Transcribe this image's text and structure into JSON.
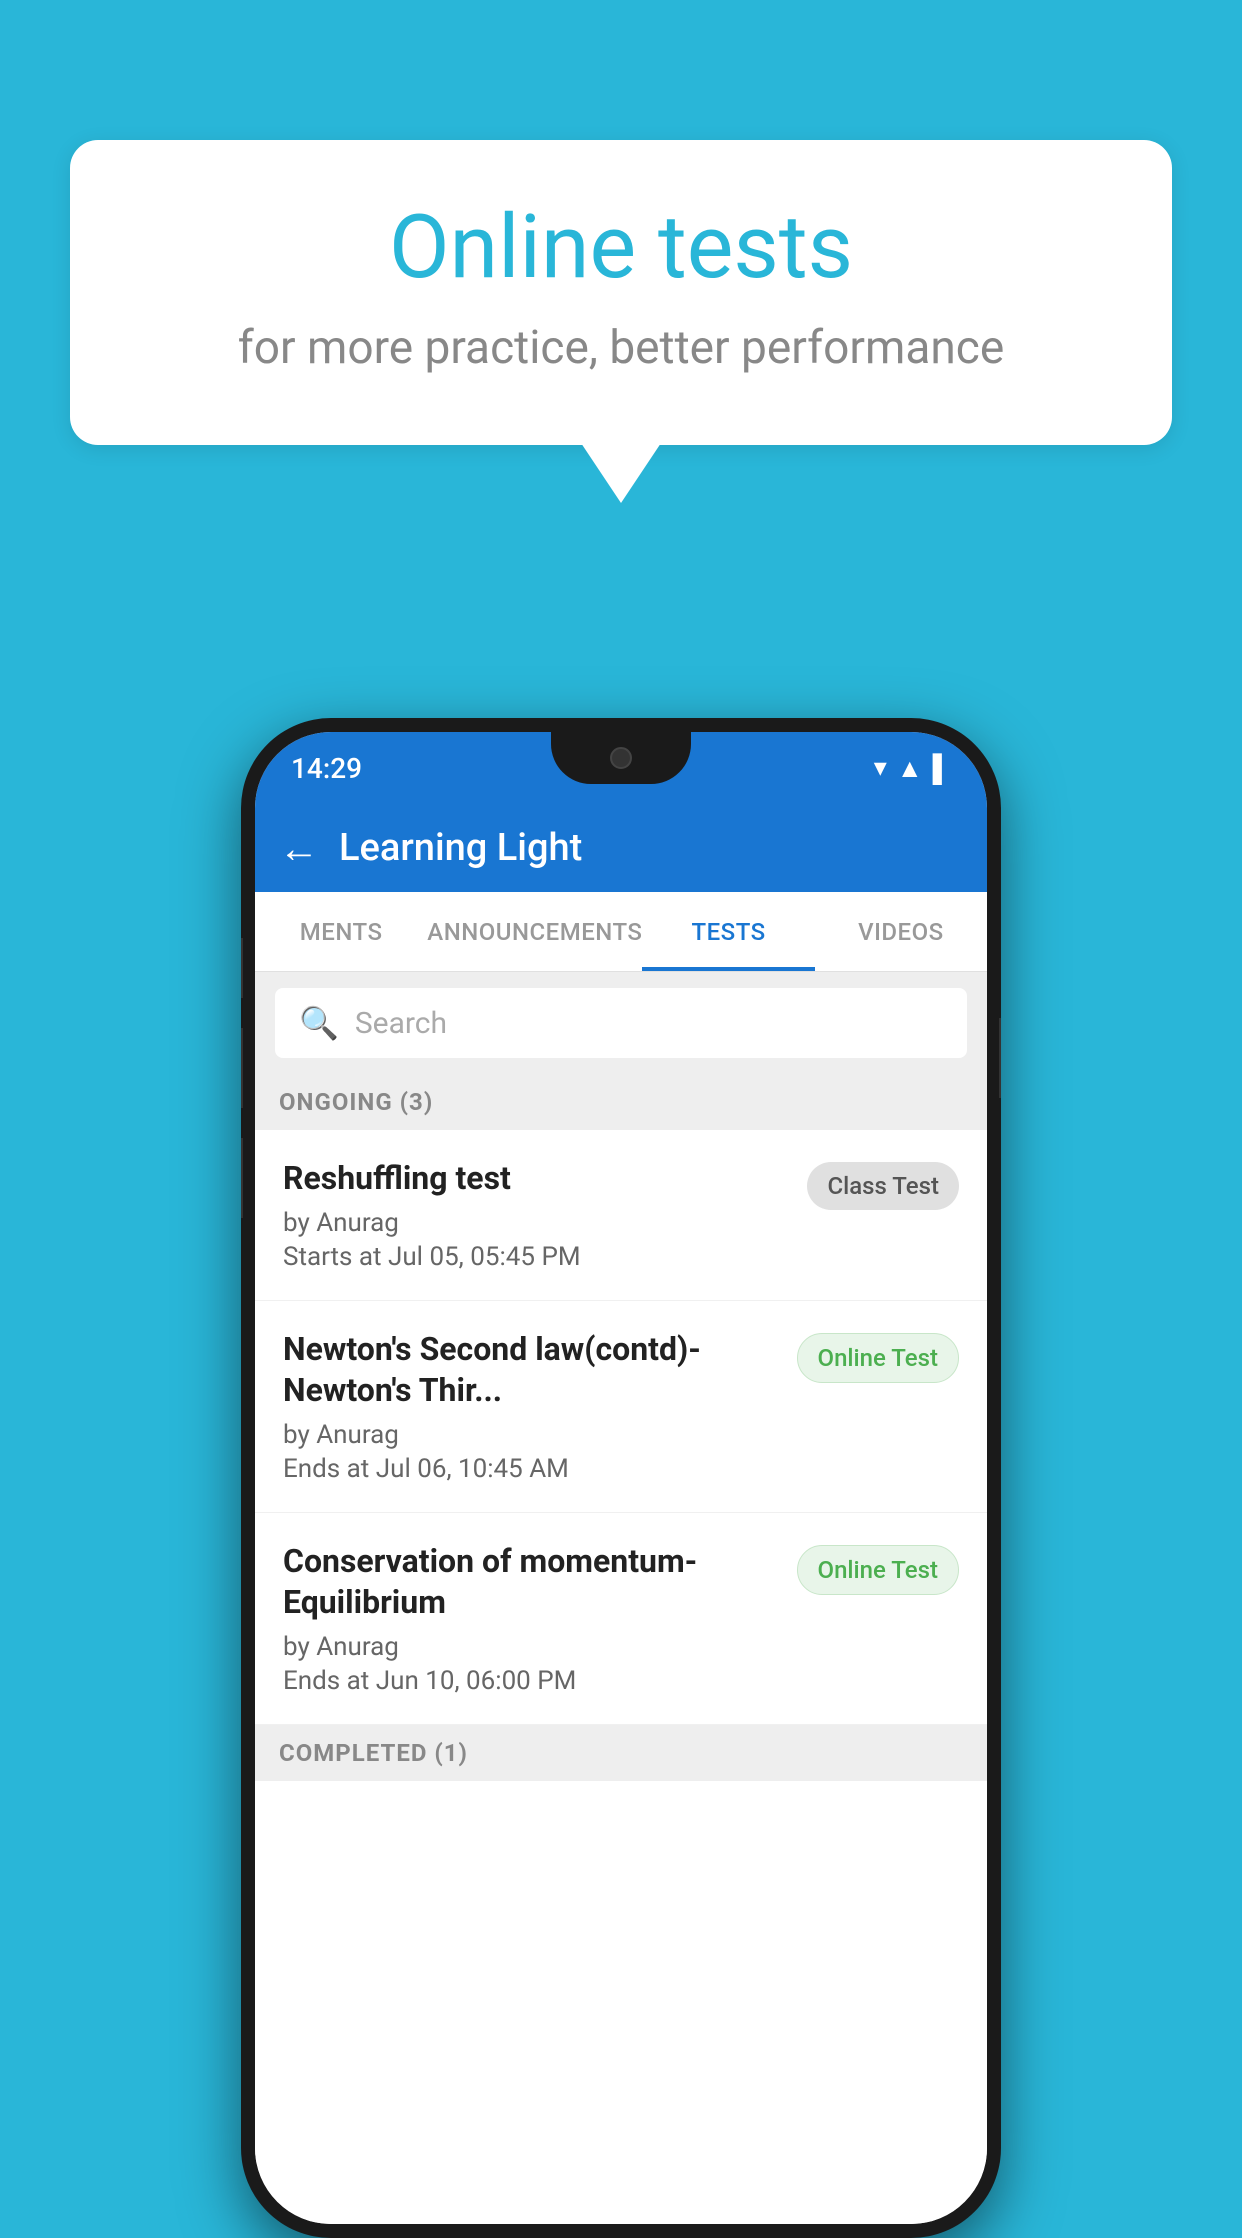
{
  "background": {
    "color": "#29b6d8"
  },
  "speech_bubble": {
    "title": "Online tests",
    "subtitle": "for more practice, better performance"
  },
  "phone": {
    "status_bar": {
      "time": "14:29",
      "icons": [
        "▼",
        "▲",
        "▌"
      ]
    },
    "app_bar": {
      "title": "Learning Light",
      "back_label": "←"
    },
    "tabs": [
      {
        "label": "MENTS",
        "active": false
      },
      {
        "label": "ANNOUNCEMENTS",
        "active": false
      },
      {
        "label": "TESTS",
        "active": true
      },
      {
        "label": "VIDEOS",
        "active": false
      }
    ],
    "search": {
      "placeholder": "Search"
    },
    "section_ongoing": {
      "label": "ONGOING (3)"
    },
    "tests_ongoing": [
      {
        "name": "Reshuffling test",
        "by": "by Anurag",
        "time": "Starts at  Jul 05, 05:45 PM",
        "badge": "Class Test",
        "badge_type": "class-test"
      },
      {
        "name": "Newton's Second law(contd)-Newton's Thir...",
        "by": "by Anurag",
        "time": "Ends at  Jul 06, 10:45 AM",
        "badge": "Online Test",
        "badge_type": "online-test"
      },
      {
        "name": "Conservation of momentum-Equilibrium",
        "by": "by Anurag",
        "time": "Ends at  Jun 10, 06:00 PM",
        "badge": "Online Test",
        "badge_type": "online-test"
      }
    ],
    "section_completed": {
      "label": "COMPLETED (1)"
    }
  }
}
